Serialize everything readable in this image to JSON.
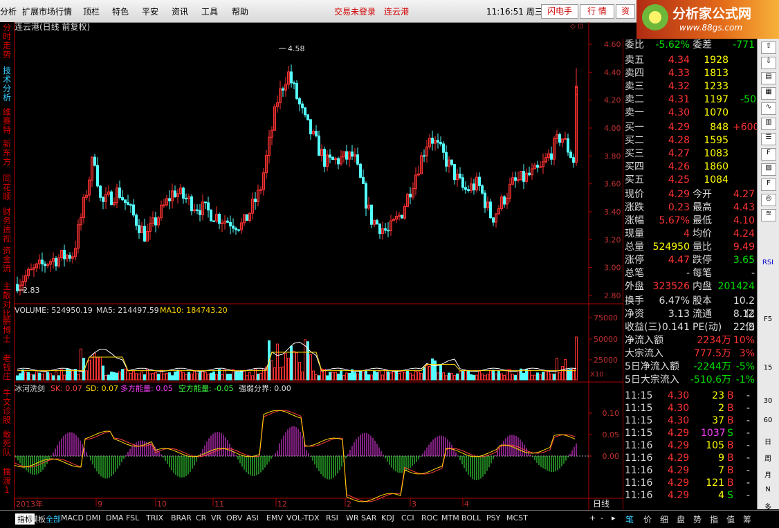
{
  "menu": {
    "items": [
      "分析",
      "扩展市场行情",
      "顶栏",
      "特色",
      "平安",
      "资讯",
      "工具",
      "帮助"
    ],
    "login": "交易未登录",
    "stock": "连云港",
    "clock": "11:16:51 周三",
    "buttons": [
      "闪电手",
      "行 情",
      "资"
    ],
    "brand": {
      "name": "分析家公式网",
      "url": "www.88gs.com"
    }
  },
  "leftnav": [
    "分时走势",
    "技术分析",
    "维赛特",
    "新东方",
    "同花顺",
    "财务透视",
    "资金流",
    "主散对比",
    "鹏博士",
    "老钱庄",
    "牛文诊股",
    "敢死队",
    "擒渡1"
  ],
  "chart": {
    "title": "连云港(日线 前复权)",
    "high_label": "4.58",
    "low_label": "2.83",
    "price_ticks": [
      "4.60",
      "4.40",
      "4.20",
      "4.00",
      "3.80",
      "3.60",
      "3.40",
      "3.20",
      "3.00",
      "2.80"
    ],
    "volume_header": {
      "vol": "VOLUME: 524950.19",
      "ma5": "MA5: 214497.59",
      "ma10": "MA10: 184743.20"
    },
    "vol_ticks": [
      "75000",
      "50000",
      "25000"
    ],
    "vol_unit": "X10",
    "ind_header": {
      "name": "冰河洗剑",
      "sk": "SK: 0.07",
      "sd": "SD: 0.07",
      "dfn": "多方能量: 0.05",
      "kfn": "空方能量: -0.05",
      "qr": "强弱分界: 0.00"
    },
    "ind_ticks": [
      "0.10",
      "0.05",
      "0.00"
    ],
    "xlabels": [
      "2013年",
      "9",
      "10",
      "11",
      "12",
      "2",
      "3",
      "4"
    ],
    "period": "日线"
  },
  "quote": {
    "wb": {
      "label": "委比",
      "value": "-5.62%",
      "label2": "委差",
      "value2": "-771"
    },
    "sell": [
      {
        "l": "卖五",
        "p": "4.34",
        "v": "1928",
        "c": ""
      },
      {
        "l": "卖四",
        "p": "4.33",
        "v": "1813",
        "c": ""
      },
      {
        "l": "卖三",
        "p": "4.32",
        "v": "1233",
        "c": ""
      },
      {
        "l": "卖二",
        "p": "4.31",
        "v": "1197",
        "c": "-50"
      },
      {
        "l": "卖一",
        "p": "4.30",
        "v": "1070",
        "c": ""
      }
    ],
    "buy": [
      {
        "l": "买一",
        "p": "4.29",
        "v": "848",
        "c": "+600"
      },
      {
        "l": "买二",
        "p": "4.28",
        "v": "1595",
        "c": ""
      },
      {
        "l": "买三",
        "p": "4.27",
        "v": "1083",
        "c": ""
      },
      {
        "l": "买四",
        "p": "4.26",
        "v": "1860",
        "c": ""
      },
      {
        "l": "买五",
        "p": "4.25",
        "v": "1084",
        "c": ""
      }
    ],
    "stats": [
      [
        "现价",
        "4.29",
        "今开",
        "4.27"
      ],
      [
        "涨跌",
        "0.23",
        "最高",
        "4.43"
      ],
      [
        "涨幅",
        "5.67%",
        "最低",
        "4.10"
      ],
      [
        "现量",
        "4",
        "均价",
        "4.24"
      ],
      [
        "总量",
        "524950",
        "量比",
        "9.49"
      ],
      [
        "涨停",
        "4.47",
        "跌停",
        "3.65"
      ],
      [
        "总笔",
        "-",
        "每笔",
        "-"
      ],
      [
        "外盘",
        "323526",
        "内盘",
        "201424"
      ]
    ],
    "info": [
      [
        "换手",
        "6.47%",
        "股本",
        "10.2亿"
      ],
      [
        "净资",
        "3.13",
        "流通",
        "8.12亿"
      ],
      [
        "收益(三)",
        "0.141",
        "PE(动)",
        "22.9"
      ]
    ],
    "flows": [
      [
        "净流入额",
        "2234万",
        "10%"
      ],
      [
        "大宗流入",
        "777.5万",
        "3%"
      ],
      [
        "5日净流入额",
        "-2244万",
        "-5%"
      ],
      [
        "5日大宗流入",
        "-510.6万",
        "-1%"
      ]
    ],
    "ticks": [
      [
        "11:15",
        "4.30",
        "23",
        "B"
      ],
      [
        "11:15",
        "4.30",
        "2",
        "B"
      ],
      [
        "11:15",
        "4.30",
        "37",
        "B"
      ],
      [
        "11:15",
        "4.29",
        "1037",
        "S"
      ],
      [
        "11:16",
        "4.29",
        "105",
        "B"
      ],
      [
        "11:16",
        "4.29",
        "9",
        "B"
      ],
      [
        "11:16",
        "4.29",
        "7",
        "B"
      ],
      [
        "11:16",
        "4.29",
        "121",
        "B"
      ],
      [
        "11:16",
        "4.29",
        "4",
        "S"
      ]
    ],
    "dash": "-"
  },
  "rightbar": [
    "RSI",
    "F5",
    "15",
    "30",
    "60",
    "日",
    "周",
    "月",
    "N",
    "多",
    "季"
  ],
  "bottom": {
    "tabs": [
      "指标",
      "模板",
      "全部",
      "MACD",
      "DMI",
      "DMA",
      "FSL",
      "TRIX",
      "BRAR",
      "CR",
      "VR",
      "OBV",
      "ASI",
      "EMV",
      "VOL-TDX",
      "RSI",
      "WR",
      "SAR",
      "KDJ",
      "CCI",
      "ROC",
      "MTM",
      "BOLL",
      "PSY",
      "MCST"
    ],
    "right": [
      "笔",
      "价",
      "细",
      "盘",
      "势",
      "指",
      "值",
      "筹"
    ]
  },
  "colors": {
    "up": "#ff3232",
    "down": "#54ffff",
    "bg": "#000000",
    "grid": "#b00000"
  }
}
